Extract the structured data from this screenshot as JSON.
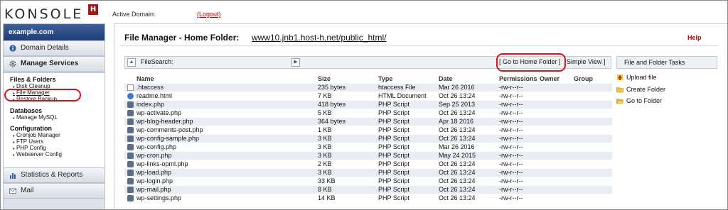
{
  "header": {
    "logo_text": "KONSOLE",
    "logo_badge": "H",
    "active_domain_label": "Active Domain:",
    "logout_label": "(Logout)"
  },
  "sidebar": {
    "domain": "example.com",
    "domain_details": "Domain Details",
    "manage_services": "Manage Services",
    "sections": [
      {
        "title": "Files & Folders",
        "items": [
          "Disk Cleanup",
          "File Manager",
          "Restore Backup"
        ]
      },
      {
        "title": "Databases",
        "items": [
          "Manage MySQL"
        ]
      },
      {
        "title": "Configuration",
        "items": [
          "Cronjob Manager",
          "FTP Users",
          "PHP Config",
          "Webserver Config"
        ]
      }
    ],
    "statistics": "Statistics & Reports",
    "mail": "Mail"
  },
  "main": {
    "title": "File Manager - Home Folder:",
    "path_domain": "www10.jnb1.host-h.net",
    "path_rest": "/public_html/",
    "help": "Help",
    "toolbar": {
      "search_label": "FileSearch:",
      "home_label": "[ Go to Home Folder ]",
      "simple_label": "Simple View ]"
    },
    "tasks_title": "File and Folder Tasks",
    "columns": [
      "Name",
      "Size",
      "Type",
      "Date",
      "Permissions",
      "Owner",
      "Group"
    ],
    "files": [
      {
        "name": ".htaccess",
        "size": "235 bytes",
        "type": "htaccess File",
        "date": "Mar 26 2016",
        "perm": "-rw-r--r--",
        "icon": "text-file-icon"
      },
      {
        "name": "readme.html",
        "size": "7 KB",
        "type": "HTML Document",
        "date": "Oct 26 13:24",
        "perm": "-rw-r--r--",
        "icon": "html-file-icon"
      },
      {
        "name": "index.php",
        "size": "418 bytes",
        "type": "PHP Script",
        "date": "Sep 25 2013",
        "perm": "-rw-r--r--",
        "icon": "php-file-icon"
      },
      {
        "name": "wp-activate.php",
        "size": "5 KB",
        "type": "PHP Script",
        "date": "Oct 26 13:24",
        "perm": "-rw-r--r--",
        "icon": "php-file-icon"
      },
      {
        "name": "wp-blog-header.php",
        "size": "364 bytes",
        "type": "PHP Script",
        "date": "Apr 18 2016",
        "perm": "-rw-r--r--",
        "icon": "php-file-icon"
      },
      {
        "name": "wp-comments-post.php",
        "size": "1 KB",
        "type": "PHP Script",
        "date": "Oct 26 13:24",
        "perm": "-rw-r--r--",
        "icon": "php-file-icon"
      },
      {
        "name": "wp-config-sample.php",
        "size": "3 KB",
        "type": "PHP Script",
        "date": "Oct 26 13:24",
        "perm": "-rw-r--r--",
        "icon": "php-file-icon"
      },
      {
        "name": "wp-config.php",
        "size": "3 KB",
        "type": "PHP Script",
        "date": "Mar 26 2016",
        "perm": "-rw-r--r--",
        "icon": "php-file-icon"
      },
      {
        "name": "wp-cron.php",
        "size": "3 KB",
        "type": "PHP Script",
        "date": "May 24 2015",
        "perm": "-rw-r--r--",
        "icon": "php-file-icon"
      },
      {
        "name": "wp-links-opml.php",
        "size": "2 KB",
        "type": "PHP Script",
        "date": "Oct 26 13:24",
        "perm": "-rw-r--r--",
        "icon": "php-file-icon"
      },
      {
        "name": "wp-load.php",
        "size": "3 KB",
        "type": "PHP Script",
        "date": "Oct 26 13:24",
        "perm": "-rw-r--r--",
        "icon": "php-file-icon"
      },
      {
        "name": "wp-login.php",
        "size": "33 KB",
        "type": "PHP Script",
        "date": "Oct 26 13:24",
        "perm": "-rw-r--r--",
        "icon": "php-file-icon"
      },
      {
        "name": "wp-mail.php",
        "size": "8 KB",
        "type": "PHP Script",
        "date": "Oct 26 13:24",
        "perm": "-rw-r--r--",
        "icon": "php-file-icon"
      },
      {
        "name": "wp-settings.php",
        "size": "14 KB",
        "type": "PHP Script",
        "date": "Oct 26 13:24",
        "perm": "-rw-r--r--",
        "icon": "php-file-icon"
      }
    ],
    "tasks": [
      {
        "label": "Upload file",
        "icon": "upload-icon"
      },
      {
        "label": "Create Folder",
        "icon": "folder-icon"
      },
      {
        "label": "Go to Folder",
        "icon": "folder-open-icon"
      }
    ]
  },
  "colors": {
    "accent_red": "#c00000",
    "sidebar_head": "#203d74",
    "highlight_circle": "#d1161b"
  }
}
